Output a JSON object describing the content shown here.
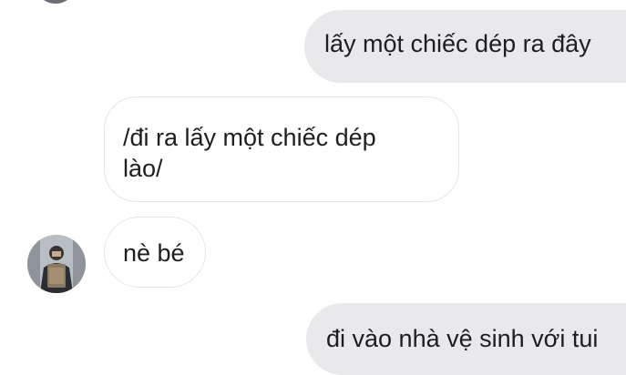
{
  "messages": [
    {
      "direction": "outgoing",
      "text": "lấy một chiếc dép ra đây"
    },
    {
      "direction": "incoming",
      "text_line1": "/đi ra lấy một chiếc dép",
      "text_line2": "lào/"
    },
    {
      "direction": "incoming",
      "text": "nè bé"
    },
    {
      "direction": "outgoing",
      "text": "đi vào nhà vệ sinh với tui"
    }
  ],
  "colors": {
    "outgoing_bubble": "#e9e9eb",
    "incoming_bubble_border": "#e4e6eb",
    "text": "#1c1e21"
  },
  "icons": [
    "avatar"
  ]
}
